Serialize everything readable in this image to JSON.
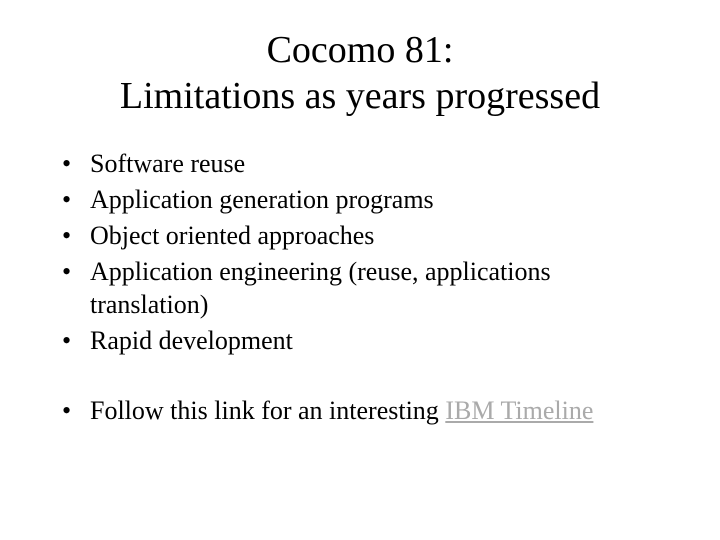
{
  "title_line1": "Cocomo 81:",
  "title_line2": "Limitations as years progressed",
  "bullets": {
    "0": "Software reuse",
    "1": "Application generation programs",
    "2": "Object oriented approaches",
    "3": "Application engineering (reuse, applications translation)",
    "4": "Rapid development"
  },
  "follow_prefix": "Follow this link for an interesting ",
  "follow_link": "IBM Timeline"
}
